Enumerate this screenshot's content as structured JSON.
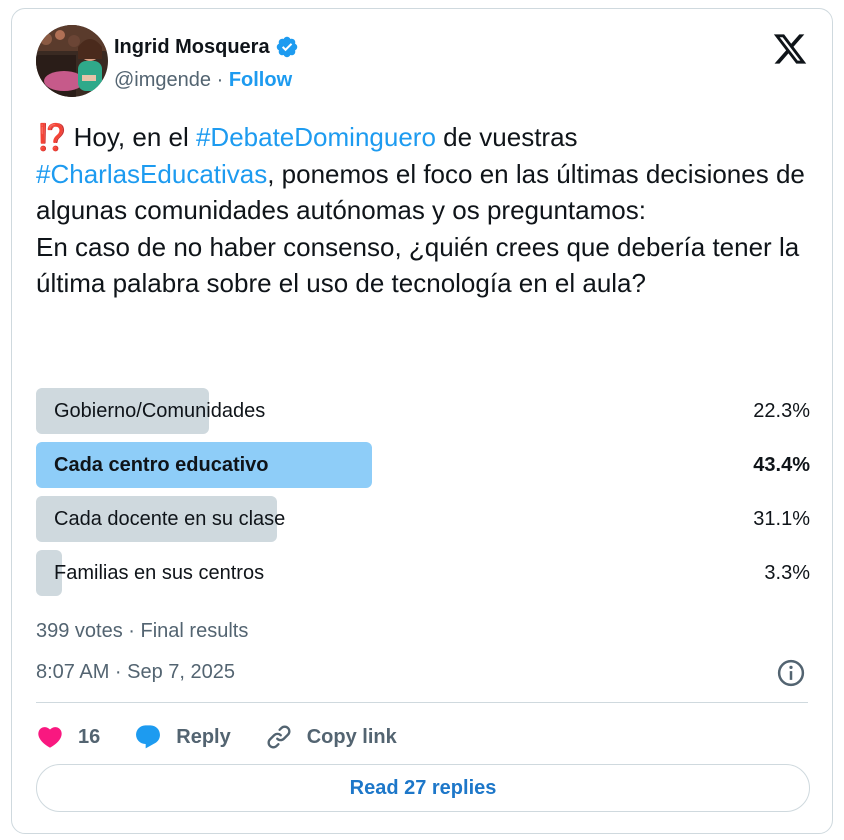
{
  "author": {
    "name": "Ingrid Mosquera",
    "handle": "@imgende",
    "separator": " · ",
    "follow_label": "Follow",
    "verified_icon": "verified-badge-icon",
    "verified_color": "#1d9bf0"
  },
  "tweet": {
    "emoji": "⁉️",
    "text_1": " Hoy, en el ",
    "hashtag_1": "#DebateDominguero",
    "text_2": " de vuestras ",
    "hashtag_2": "#CharlasEducativas",
    "text_3": ", ponemos el foco en las últimas decisiones de algunas comunidades autónomas y os preguntamos:",
    "text_4": "En caso de no haber consenso, ¿quién crees que debería tener la última palabra sobre el uso de tecnología en el aula?"
  },
  "poll": {
    "options": [
      {
        "label": "Gobierno/Comunidades",
        "percent_text": "22.3%",
        "percent": 22.3,
        "winner": false
      },
      {
        "label": "Cada centro educativo",
        "percent_text": "43.4%",
        "percent": 43.4,
        "winner": true
      },
      {
        "label": "Cada docente en su clase",
        "percent_text": "31.1%",
        "percent": 31.1,
        "winner": false
      },
      {
        "label": "Familias en sus centros",
        "percent_text": "3.3%",
        "percent": 3.3,
        "winner": false
      }
    ],
    "meta": "399 votes · Final results"
  },
  "timestamp": "8:07 AM · Sep 7, 2025",
  "actions": {
    "like_count": "16",
    "reply_label": "Reply",
    "copy_link_label": "Copy link"
  },
  "read_replies_label": "Read 27 replies",
  "colors": {
    "accent": "#1d9bf0",
    "like": "#f91880",
    "poll_winner": "#8ecdf8",
    "poll_default": "#cfd9de"
  }
}
